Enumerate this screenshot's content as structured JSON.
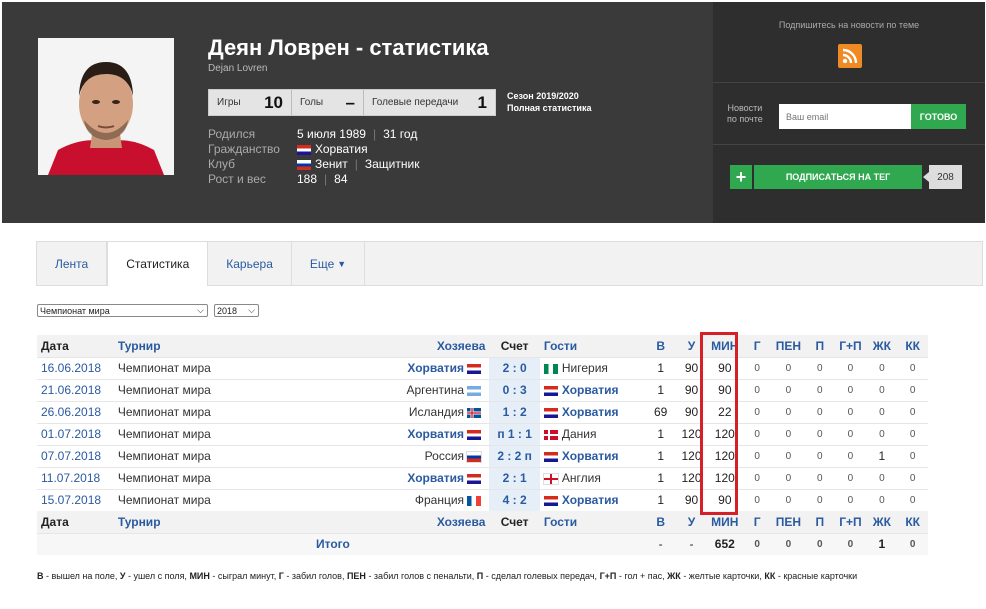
{
  "header": {
    "name": "Деян Ловрен - статистика",
    "latin_name": "Dejan Lovren",
    "stats": [
      {
        "label": "Игры",
        "value": "10"
      },
      {
        "label": "Голы",
        "value": "–"
      },
      {
        "label": "Голевые передачи",
        "value": "1"
      }
    ],
    "season": "Сезон 2019/2020",
    "full_stats": "Полная статистика",
    "info": {
      "born_label": "Родился",
      "born": "5 июля 1989",
      "age": "31 год",
      "citizenship_label": "Гражданство",
      "citizenship": "Хорватия",
      "club_label": "Клуб",
      "club": "Зенит",
      "position": "Защитник",
      "hw_label": "Рост и вес",
      "height": "188",
      "weight": "84"
    }
  },
  "sidebar": {
    "subscribe_text": "Подпишитесь на новости по теме",
    "news_label_1": "Новости",
    "news_label_2": "по почте",
    "email_placeholder": "Ваш email",
    "done_button": "ГОТОВО",
    "subscribe_tag": "ПОДПИСАТЬСЯ НА ТЕГ",
    "subscribers": "208"
  },
  "tabs": [
    "Лента",
    "Статистика",
    "Карьера",
    "Еще"
  ],
  "filters": {
    "tournament": "Чемпионат мира",
    "year": "2018"
  },
  "table": {
    "headers": [
      "Дата",
      "Турнир",
      "Хозяева",
      "Счет",
      "Гости",
      "В",
      "У",
      "МИН",
      "Г",
      "ПЕН",
      "П",
      "Г+П",
      "ЖК",
      "КК"
    ],
    "rows": [
      {
        "date": "16.06.2018",
        "tour": "Чемпионат мира",
        "home": "Хорватия",
        "score": "2 : 0",
        "guest": "Нигерия",
        "v": "1",
        "u": "90",
        "min": "90",
        "g": "0",
        "pen": "0",
        "p": "0",
        "gp": "0",
        "zk": "0",
        "kk": "0"
      },
      {
        "date": "21.06.2018",
        "tour": "Чемпионат мира",
        "home": "Аргентина",
        "score": "0 : 3",
        "guest": "Хорватия",
        "v": "1",
        "u": "90",
        "min": "90",
        "g": "0",
        "pen": "0",
        "p": "0",
        "gp": "0",
        "zk": "0",
        "kk": "0"
      },
      {
        "date": "26.06.2018",
        "tour": "Чемпионат мира",
        "home": "Исландия",
        "score": "1 : 2",
        "guest": "Хорватия",
        "v": "69",
        "u": "90",
        "min": "22",
        "g": "0",
        "pen": "0",
        "p": "0",
        "gp": "0",
        "zk": "0",
        "kk": "0"
      },
      {
        "date": "01.07.2018",
        "tour": "Чемпионат мира",
        "home": "Хорватия",
        "score": "п 1 : 1",
        "guest": "Дания",
        "v": "1",
        "u": "120",
        "min": "120",
        "g": "0",
        "pen": "0",
        "p": "0",
        "gp": "0",
        "zk": "0",
        "kk": "0"
      },
      {
        "date": "07.07.2018",
        "tour": "Чемпионат мира",
        "home": "Россия",
        "score": "2 : 2 п",
        "guest": "Хорватия",
        "v": "1",
        "u": "120",
        "min": "120",
        "g": "0",
        "pen": "0",
        "p": "0",
        "gp": "0",
        "zk": "1",
        "kk": "0"
      },
      {
        "date": "11.07.2018",
        "tour": "Чемпионат мира",
        "home": "Хорватия",
        "score": "2 : 1",
        "guest": "Англия",
        "v": "1",
        "u": "120",
        "min": "120",
        "g": "0",
        "pen": "0",
        "p": "0",
        "gp": "0",
        "zk": "0",
        "kk": "0"
      },
      {
        "date": "15.07.2018",
        "tour": "Чемпионат мира",
        "home": "Франция",
        "score": "4 : 2",
        "guest": "Хорватия",
        "v": "1",
        "u": "90",
        "min": "90",
        "g": "0",
        "pen": "0",
        "p": "0",
        "gp": "0",
        "zk": "0",
        "kk": "0"
      }
    ],
    "total": {
      "label": "Итого",
      "v": "-",
      "u": "-",
      "min": "652",
      "g": "0",
      "pen": "0",
      "p": "0",
      "gp": "0",
      "zk": "1",
      "kk": "0"
    }
  },
  "legend": [
    {
      "k": "В",
      "t": " - вышел на поле, "
    },
    {
      "k": "У",
      "t": " - ушел с поля, "
    },
    {
      "k": "МИН",
      "t": " - сыграл минут, "
    },
    {
      "k": "Г",
      "t": " - забил голов, "
    },
    {
      "k": "ПЕН",
      "t": " - забил голов с пенальти, "
    },
    {
      "k": "П",
      "t": " - сделал голевых передач, "
    },
    {
      "k": "Г+П",
      "t": " - гол + пас, "
    },
    {
      "k": "ЖК",
      "t": " - желтые карточки, "
    },
    {
      "k": "КК",
      "t": " - красные карточки"
    }
  ],
  "colors": {
    "croatia": "#d52b1e",
    "russia": "#0039a6",
    "highlight": "#d62027",
    "green": "#2fa84f",
    "rss": "#f08a24"
  }
}
